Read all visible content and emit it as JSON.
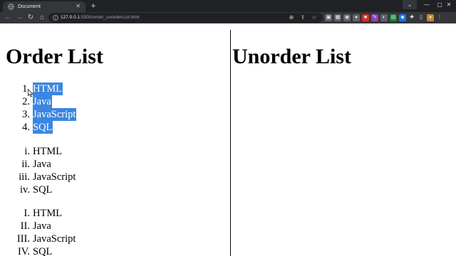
{
  "browser": {
    "tab_title": "Document",
    "tab_close": "✕",
    "new_tab": "+",
    "url_host": "127.0.0.1",
    "url_path": ":5500/order_unorderList.html",
    "window_controls": {
      "search": "⌄",
      "minimize": "—",
      "maximize": "▢",
      "close": "✕"
    },
    "nav": {
      "back": "←",
      "forward": "→",
      "reload": "↻",
      "home": "⌂"
    },
    "omnibox_icons": [
      "⊕",
      "⇪",
      "☆"
    ],
    "extension_icons": [
      {
        "name": "camera-extension-icon",
        "glyph": "▣",
        "color": "#5f6368"
      },
      {
        "name": "grid-extension-icon",
        "glyph": "▦",
        "color": "#5f6368"
      },
      {
        "name": "circle-extension-icon",
        "glyph": "◉",
        "color": "#5f6368"
      },
      {
        "name": "recorder-extension-icon",
        "glyph": "●",
        "color": "#5f6368"
      },
      {
        "name": "red-extension-icon",
        "glyph": "■",
        "color": "#d93025"
      },
      {
        "name": "pen-extension-icon",
        "glyph": "✎",
        "color": "#8e44ad"
      },
      {
        "name": "dark-extension-icon",
        "glyph": "◐",
        "color": "#5f6368"
      },
      {
        "name": "sheets-extension-icon",
        "glyph": "▤",
        "color": "#188038"
      },
      {
        "name": "blue-extension-icon",
        "glyph": "◆",
        "color": "#1a73e8"
      },
      {
        "name": "puzzle-extension-icon",
        "glyph": "✚",
        "color": "#35363a"
      },
      {
        "name": "sidepanel-icon",
        "glyph": "▯",
        "color": "#35363a"
      },
      {
        "name": "profile-icon",
        "glyph": "●",
        "color": "#c5892f"
      },
      {
        "name": "menu-icon",
        "glyph": "⋮",
        "color": "#35363a"
      }
    ]
  },
  "page": {
    "left_heading": "Order List",
    "right_heading": "Unorder List",
    "lists": [
      {
        "name": "ordered-list-decimal",
        "selected": true,
        "items": [
          {
            "marker": "1.",
            "text": "HTML"
          },
          {
            "marker": "2.",
            "text": "Java"
          },
          {
            "marker": "3.",
            "text": "JavaScript"
          },
          {
            "marker": "4.",
            "text": "SQL"
          }
        ]
      },
      {
        "name": "ordered-list-lower-roman",
        "selected": false,
        "items": [
          {
            "marker": "i.",
            "text": "HTML"
          },
          {
            "marker": "ii.",
            "text": "Java"
          },
          {
            "marker": "iii.",
            "text": "JavaScript"
          },
          {
            "marker": "iv.",
            "text": "SQL"
          }
        ]
      },
      {
        "name": "ordered-list-upper-roman",
        "selected": false,
        "items": [
          {
            "marker": "I.",
            "text": "HTML"
          },
          {
            "marker": "II.",
            "text": "Java"
          },
          {
            "marker": "III.",
            "text": "JavaScript"
          },
          {
            "marker": "IV.",
            "text": "SQL"
          }
        ]
      }
    ]
  },
  "colors": {
    "selection": "#3b86e0",
    "chrome_dark": "#202124",
    "chrome_toolbar": "#35363a"
  }
}
